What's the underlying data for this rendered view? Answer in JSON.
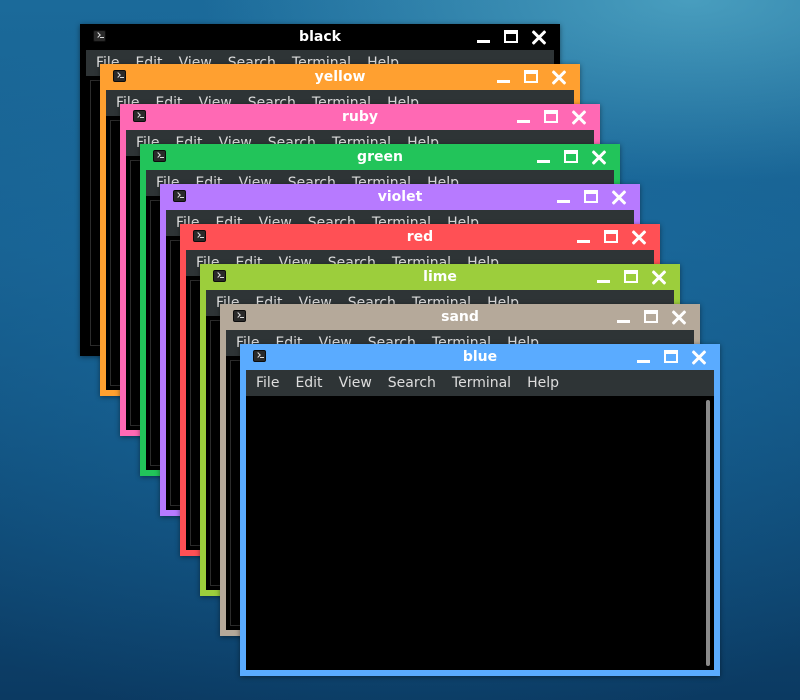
{
  "windows": [
    {
      "title": "black",
      "color": "#000000"
    },
    {
      "title": "yellow",
      "color": "#ffa030"
    },
    {
      "title": "ruby",
      "color": "#ff69b4"
    },
    {
      "title": "green",
      "color": "#22c45a"
    },
    {
      "title": "violet",
      "color": "#b77aff"
    },
    {
      "title": "red",
      "color": "#ff5055"
    },
    {
      "title": "lime",
      "color": "#9cce3c"
    },
    {
      "title": "sand",
      "color": "#b5a99a"
    },
    {
      "title": "blue",
      "color": "#5aabff"
    }
  ],
  "menu": [
    "File",
    "Edit",
    "View",
    "Search",
    "Terminal",
    "Help"
  ],
  "icons": {
    "app": "terminal-app-icon",
    "minimize": "minimize-icon",
    "maximize": "maximize-icon",
    "close": "close-icon"
  }
}
